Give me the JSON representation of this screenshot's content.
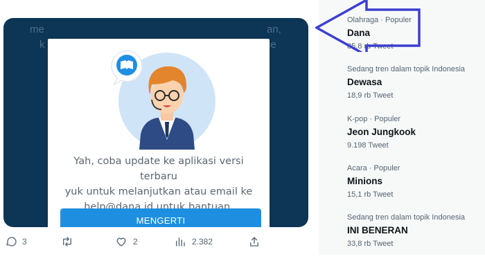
{
  "media": {
    "background_text": {
      "line1_left": "me",
      "line1_right": "an,",
      "line2_left": "k",
      "line2_right": "ce"
    },
    "dialog": {
      "message_lines": [
        "Yah, coba update ke aplikasi versi terbaru",
        "yuk untuk melanjutkan atau email ke",
        "help@dana.id untuk bantuan."
      ],
      "button_label": "MENGERTI"
    }
  },
  "actions": {
    "reply_count": "3",
    "retweet_count": "",
    "like_count": "2",
    "views_count": "2.382"
  },
  "trends": [
    {
      "context": "Olahraga · Populer",
      "name": "Dana",
      "count": "85,8 rb Tweet"
    },
    {
      "context": "Sedang tren dalam topik Indonesia",
      "name": "Dewasa",
      "count": "18,9 rb Tweet"
    },
    {
      "context": "K-pop · Populer",
      "name": "Jeon Jungkook",
      "count": "9.198 Tweet"
    },
    {
      "context": "Acara · Populer",
      "name": "Minions",
      "count": "15,1 rb Tweet"
    },
    {
      "context": "Sedang tren dalam topik Indonesia",
      "name": "INI BENERAN",
      "count": "33,8 rb Tweet"
    }
  ],
  "colors": {
    "media_background": "#0c3556",
    "dialog_button": "#1e8fe0",
    "annotation_arrow": "#3c3fd0",
    "trends_panel": "#f7f9f9"
  },
  "icons": [
    "chat-bubble-icon",
    "reply-icon",
    "retweet-icon",
    "like-icon",
    "views-icon",
    "share-icon",
    "annotation-arrow-icon"
  ]
}
